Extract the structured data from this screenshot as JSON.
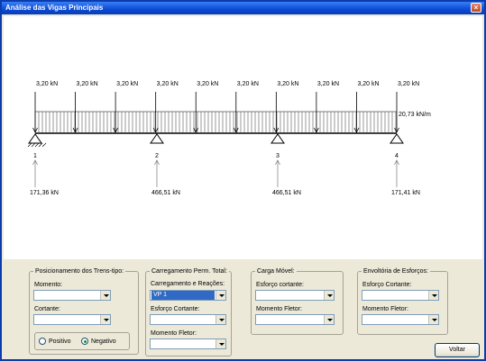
{
  "window": {
    "title": "Análise das Vigas Principais",
    "close_symbol": "×"
  },
  "diagram": {
    "point_loads": [
      "3,20 kN",
      "3,20 kN",
      "3,20 kN",
      "3,20 kN",
      "3,20 kN",
      "3,20 kN",
      "3,20 kN",
      "3,20 kN",
      "3,20 kN",
      "3,20 kN"
    ],
    "distributed_load": "20,73 kN/m",
    "supports": [
      {
        "number": "1",
        "reaction": "171,36 kN"
      },
      {
        "number": "2",
        "reaction": "466,51 kN"
      },
      {
        "number": "3",
        "reaction": "466,51 kN"
      },
      {
        "number": "4",
        "reaction": "171,41 kN"
      }
    ]
  },
  "groups": {
    "trens_tipo": {
      "legend": "Posicionamento dos Trens-tipo:",
      "momento_label": "Momento:",
      "momento_value": "",
      "cortante_label": "Cortante:",
      "cortante_value": "",
      "radio_positivo": "Positivo",
      "radio_negativo": "Negativo"
    },
    "carregamento": {
      "legend": "Carregamento Perm. Total:",
      "reacoes_label": "Carregamento e Reações:",
      "reacoes_value": "VP 1",
      "cortante_label": "Esforço Cortante:",
      "cortante_value": "",
      "fletor_label": "Momento Fletor:",
      "fletor_value": ""
    },
    "carga_movel": {
      "legend": "Carga Móvel:",
      "cortante_label": "Esforço cortante:",
      "cortante_value": "",
      "fletor_label": "Momento Fletor:",
      "fletor_value": ""
    },
    "envoltoria": {
      "legend": "Envoltória de Esforços:",
      "cortante_label": "Esforço Cortante:",
      "cortante_value": "",
      "fletor_label": "Momento Fletor:",
      "fletor_value": ""
    }
  },
  "buttons": {
    "voltar": "Voltar"
  }
}
